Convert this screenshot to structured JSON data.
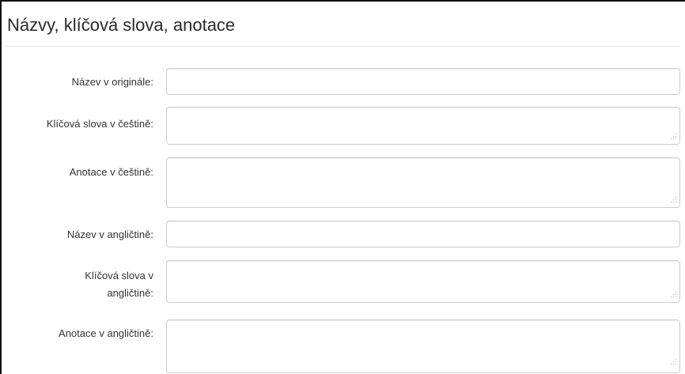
{
  "panel": {
    "title": "Názvy, klíčová slova, anotace"
  },
  "fields": {
    "title_original": {
      "label": "Název v originále:",
      "value": ""
    },
    "keywords_czech": {
      "label": "Klíčová slova v češtině:",
      "value": ""
    },
    "abstract_czech": {
      "label": "Anotace v češtině:",
      "value": ""
    },
    "title_english": {
      "label": "Název v angličtině:",
      "value": ""
    },
    "keywords_english": {
      "label_line1": "Klíčová slova v",
      "label_line2": "angličtině:",
      "value": ""
    },
    "abstract_english": {
      "label": "Anotace v angličtině:",
      "value": ""
    }
  },
  "icons": {
    "resize_handle": "resize-grip-icon"
  }
}
